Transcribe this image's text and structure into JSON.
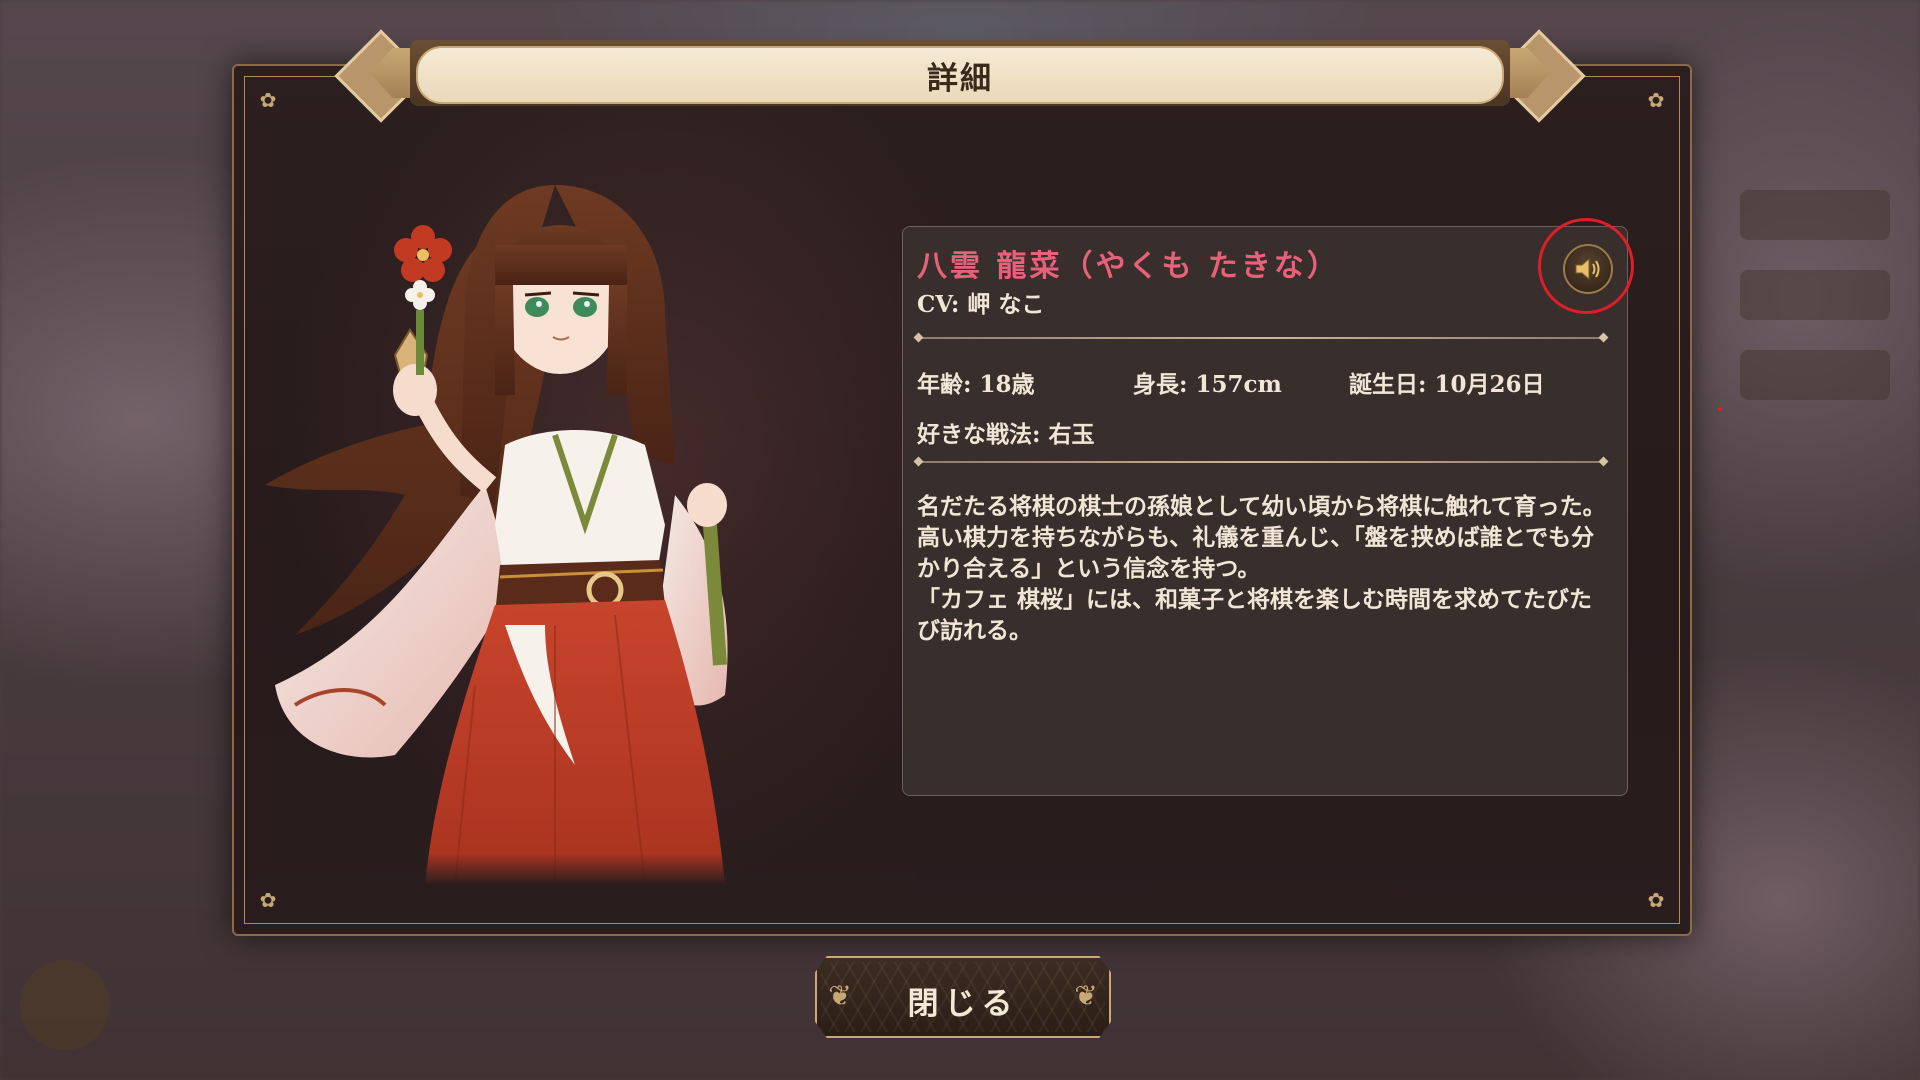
{
  "dialog": {
    "title": "詳細"
  },
  "character": {
    "name": "八雲 龍菜（やくも たきな）",
    "cv": "CV: 岬 なこ",
    "age": "年齢: 18歳",
    "height": "身長: 157cm",
    "birthday": "誕生日: 10月26日",
    "favorite_tactic": "好きな戦法: 右玉",
    "bio": [
      "名だたる将棋の棋士の孫娘として幼い頃から将棋に触れて育った。",
      "高い棋力を持ちながらも、礼儀を重んじ、「盤を挟めば誰とでも分かり合える」という信念を持つ。",
      "「カフェ 棋桜」には、和菓子と将棋を楽しむ時間を求めてたびたび訪れる。"
    ]
  },
  "buttons": {
    "close_label": "閉じる"
  },
  "icons": {
    "voice": "speaker-icon",
    "corner": "sakura-flower-icon"
  },
  "colors": {
    "name_accent": "#e8607a",
    "highlight_ring": "#e01e2a",
    "gold": "#c9a877"
  }
}
